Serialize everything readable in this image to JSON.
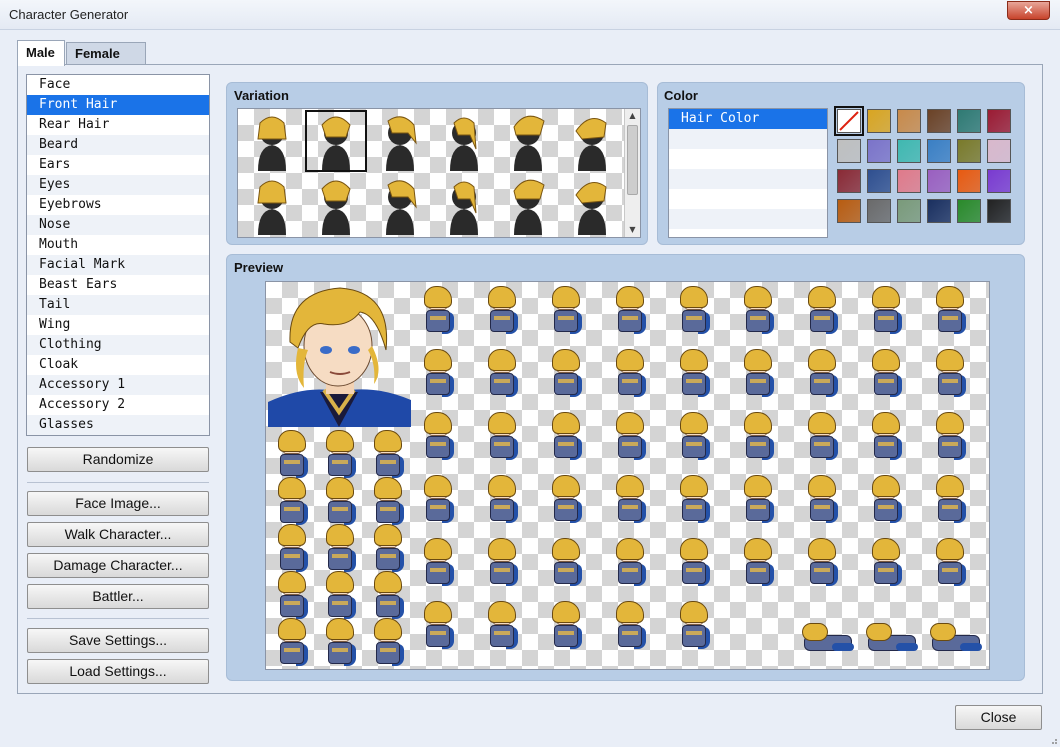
{
  "window": {
    "title": "Character Generator",
    "close_glyph": "×"
  },
  "tabs": [
    {
      "label": "Male",
      "active": true
    },
    {
      "label": "Female",
      "active": false
    }
  ],
  "parts": {
    "selected": "Front Hair",
    "items": [
      "Face",
      "Front Hair",
      "Rear Hair",
      "Beard",
      "Ears",
      "Eyes",
      "Eyebrows",
      "Nose",
      "Mouth",
      "Facial Mark",
      "Beast Ears",
      "Tail",
      "Wing",
      "Clothing",
      "Cloak",
      "Accessory 1",
      "Accessory 2",
      "Glasses"
    ]
  },
  "buttons": {
    "randomize": "Randomize",
    "face_image": "Face Image...",
    "walk_character": "Walk Character...",
    "damage_character": "Damage Character...",
    "battler": "Battler...",
    "save_settings": "Save Settings...",
    "load_settings": "Load Settings...",
    "close": "Close"
  },
  "variation": {
    "label": "Variation",
    "selected_index": 1,
    "scroll_up_icon": "triangle-up-icon",
    "scroll_down_icon": "triangle-down-icon"
  },
  "color": {
    "label": "Color",
    "rows": [
      "Hair Color",
      "",
      "",
      "",
      "",
      ""
    ],
    "selected_row": 0,
    "swatches": [
      "none",
      "#d9a521",
      "#c88a4a",
      "#6b4226",
      "#2f7a73",
      "#9b1b33",
      "#bfbfbf",
      "#7b73c9",
      "#3fb8b0",
      "#3a7fc4",
      "#7a7a2a",
      "#d9b8cc",
      "#8a2a35",
      "#2f4f8f",
      "#e07a8a",
      "#9a5fc0",
      "#e85a10",
      "#7a3ad0",
      "#b85c10",
      "#6a6a6a",
      "#7a9a7a",
      "#1a2f5f",
      "#2a8a2a",
      "#222222"
    ],
    "selected_swatch": 0,
    "none_swatch_icon": "no-color-slash-icon"
  },
  "preview": {
    "label": "Preview",
    "colors": {
      "hair": "#e3b63a",
      "armor": "#5a6a9a",
      "cape": "#2451a8",
      "skin": "#f6dcc3",
      "trim": "#c9a95a"
    }
  }
}
